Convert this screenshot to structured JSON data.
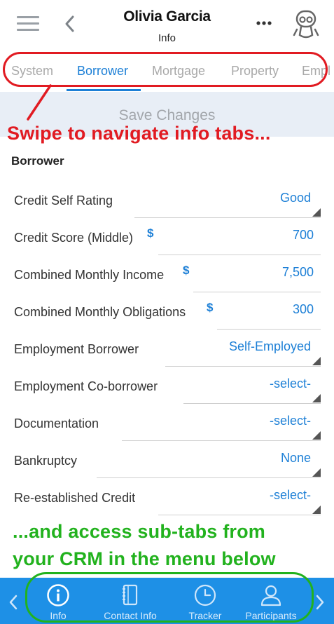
{
  "header": {
    "title": "Olivia Garcia",
    "subtitle": "Info",
    "icons": [
      "hamburger-menu-icon",
      "back-chevron-icon",
      "more-options-icon",
      "robot-avatar-icon"
    ]
  },
  "tabs": [
    {
      "label": "System",
      "active": false
    },
    {
      "label": "Borrower",
      "active": true
    },
    {
      "label": "Mortgage",
      "active": false
    },
    {
      "label": "Property",
      "active": false
    },
    {
      "label": "Empl",
      "active": false
    }
  ],
  "save_button": {
    "label": "Save Changes"
  },
  "callouts": {
    "top": "Swipe to navigate info tabs...",
    "bottom_line1": "...and access sub-tabs from",
    "bottom_line2": "your CRM in the menu below"
  },
  "section": {
    "title": "Borrower"
  },
  "fields": [
    {
      "label": "Credit Self Rating",
      "value": "Good",
      "type": "select",
      "currency": false
    },
    {
      "label": "Credit Score (Middle)",
      "value": "700",
      "type": "number",
      "currency": true
    },
    {
      "label": "Combined Monthly Income",
      "value": "7,500",
      "type": "number",
      "currency": true
    },
    {
      "label": "Combined Monthly Obligations",
      "value": "300",
      "type": "number",
      "currency": true
    },
    {
      "label": "Employment Borrower",
      "value": "Self-Employed",
      "type": "select",
      "currency": false
    },
    {
      "label": "Employment Co-borrower",
      "value": "-select-",
      "type": "select",
      "currency": false
    },
    {
      "label": "Documentation",
      "value": "-select-",
      "type": "select",
      "currency": false
    },
    {
      "label": "Bankruptcy",
      "value": "None",
      "type": "select",
      "currency": false
    },
    {
      "label": "Re-established Credit",
      "value": "-select-",
      "type": "select",
      "currency": false
    }
  ],
  "currency_symbol": "$",
  "bottom_nav": [
    {
      "label": "Info",
      "icon": "info-icon"
    },
    {
      "label": "Contact Info",
      "icon": "address-book-icon"
    },
    {
      "label": "Tracker",
      "icon": "clock-icon"
    },
    {
      "label": "Participants",
      "icon": "user-icon"
    }
  ],
  "colors": {
    "accent": "#1c7fd6",
    "bottom_bar": "#1e90e6",
    "callout_red": "#e11b22",
    "callout_green": "#22b21e"
  }
}
